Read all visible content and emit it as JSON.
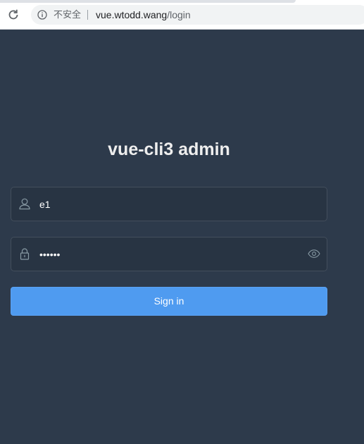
{
  "browser": {
    "security_label": "不安全",
    "url_host": "vue.wtodd.wang",
    "url_path": "/login"
  },
  "login": {
    "title": "vue-cli3 admin",
    "username_value": "e1",
    "password_value": "••••••",
    "signin_label": "Sign in"
  },
  "colors": {
    "background": "#2d3a4b",
    "field_bg": "#283443",
    "button": "#4f9bf0",
    "title": "#eeeeee"
  },
  "icons": {
    "reload": "reload-icon",
    "info": "info-icon",
    "user": "user-icon",
    "lock": "lock-icon",
    "eye": "eye-icon"
  }
}
